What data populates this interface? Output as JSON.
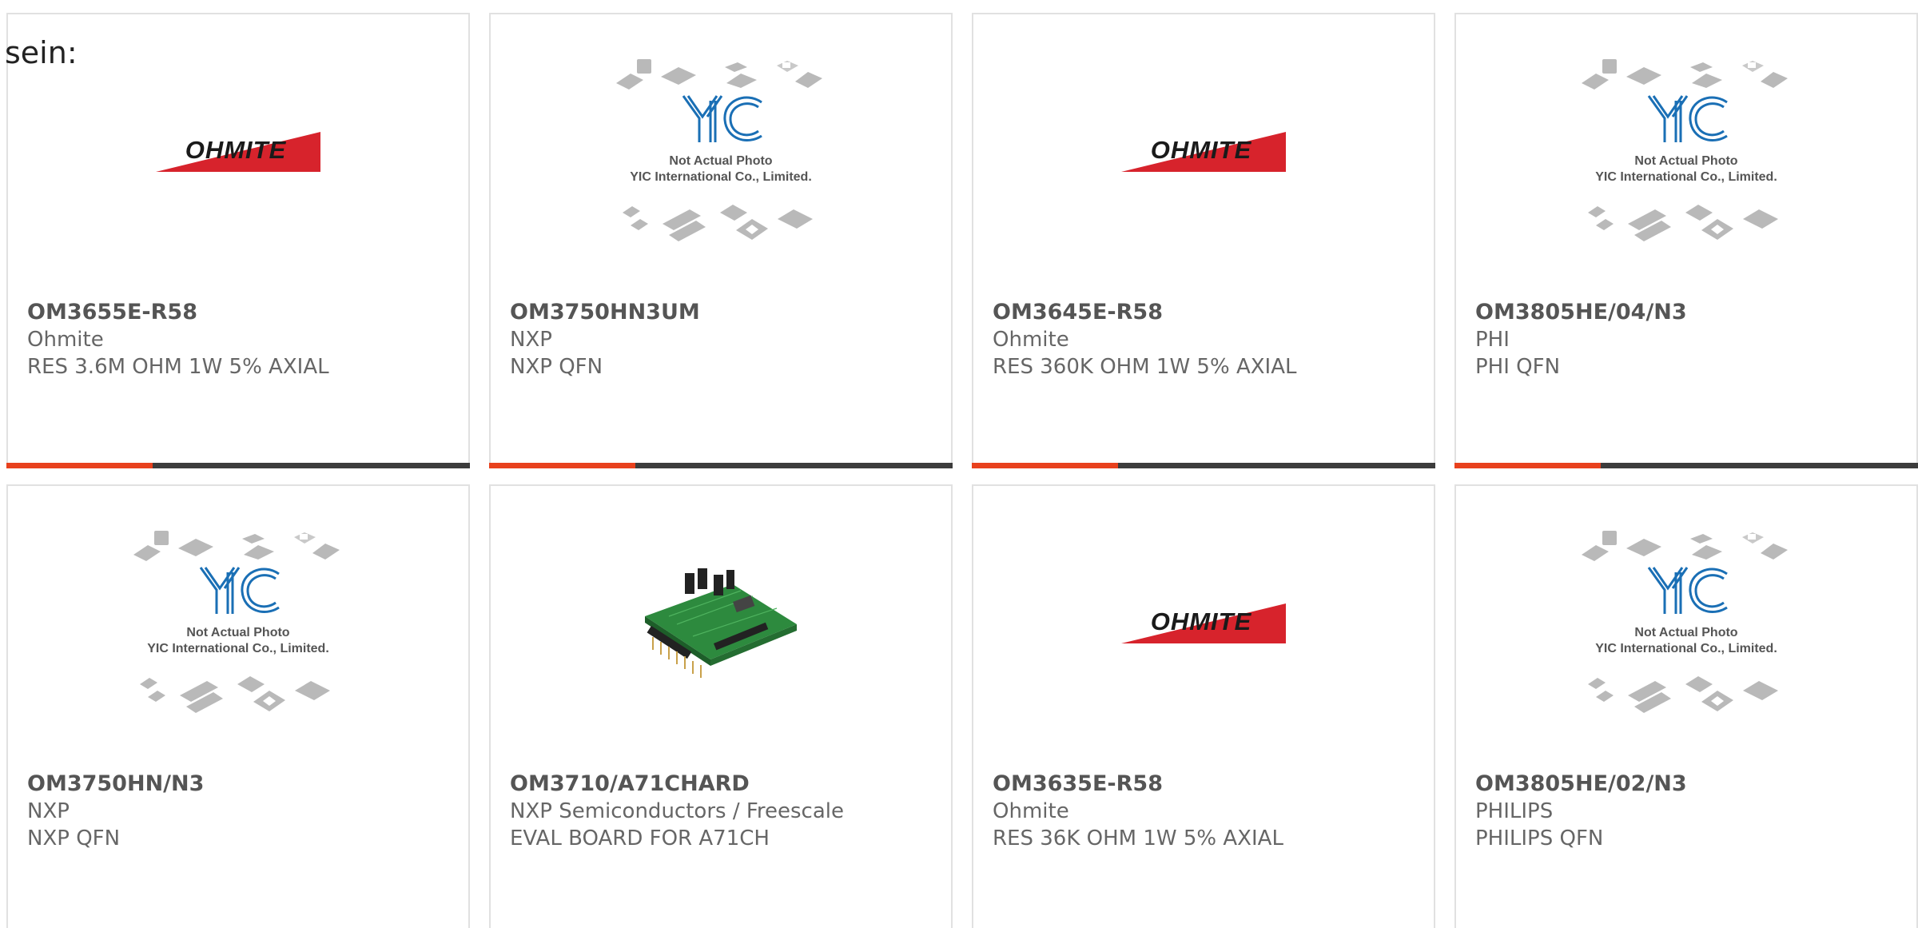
{
  "intro_text": "sein:",
  "placeholder": {
    "brand": "YIC",
    "line1": "Not Actual Photo",
    "line2": "YIC International Co., Limited."
  },
  "ohmite_logo_text": "OHMITE",
  "colors": {
    "accent": "#e8411d",
    "bar": "#3c3c3c",
    "ohmite_red": "#d7232c",
    "yic_blue": "#1a6fb5"
  },
  "products": [
    {
      "part": "OM3655E-R58",
      "maker": "Ohmite",
      "desc": "RES 3.6M OHM 1W 5% AXIAL",
      "image": "ohmite-logo"
    },
    {
      "part": "OM3750HN3UM",
      "maker": "NXP",
      "desc": "NXP QFN",
      "image": "yic-placeholder"
    },
    {
      "part": "OM3645E-R58",
      "maker": "Ohmite",
      "desc": "RES 360K OHM 1W 5% AXIAL",
      "image": "ohmite-logo"
    },
    {
      "part": "OM3805HE/04/N3",
      "maker": "PHI",
      "desc": "PHI QFN",
      "image": "yic-placeholder"
    },
    {
      "part": "OM3750HN/N3",
      "maker": "NXP",
      "desc": "NXP QFN",
      "image": "yic-placeholder"
    },
    {
      "part": "OM3710/A71CHARD",
      "maker": "NXP Semiconductors / Freescale",
      "desc": "EVAL BOARD FOR A71CH",
      "image": "pcb-board"
    },
    {
      "part": "OM3635E-R58",
      "maker": "Ohmite",
      "desc": "RES 36K OHM 1W 5% AXIAL",
      "image": "ohmite-logo"
    },
    {
      "part": "OM3805HE/02/N3",
      "maker": "PHILIPS",
      "desc": "PHILIPS QFN",
      "image": "yic-placeholder"
    }
  ]
}
